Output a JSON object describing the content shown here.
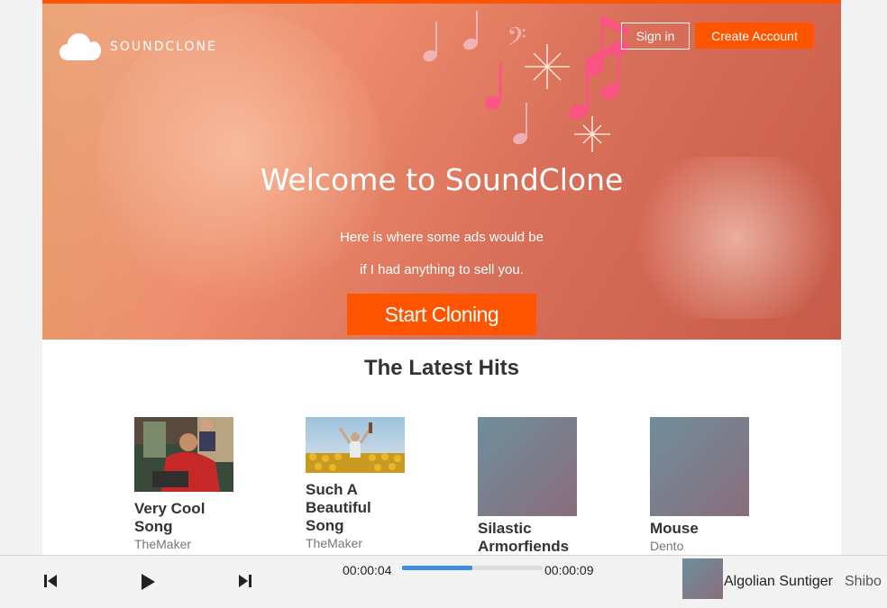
{
  "header": {
    "logo_text": "SOUNDCLONE",
    "signin_label": "Sign in",
    "create_account_label": "Create Account"
  },
  "hero": {
    "title": "Welcome to SoundClone",
    "subtitle_line1": "Here is where some ads would be",
    "subtitle_line2": "if I had anything to sell you.",
    "cta_label": "Start Cloning"
  },
  "latest": {
    "heading": "The Latest Hits",
    "tracks": [
      {
        "title": "Very Cool Song",
        "artist": "TheMaker",
        "art": "photo-people-street"
      },
      {
        "title": "Such A Beautiful Song",
        "artist": "TheMaker",
        "art": "photo-sunflower-field"
      },
      {
        "title": "Silastic Armorfiends",
        "artist": "",
        "art": "gradient-placeholder"
      },
      {
        "title": "Mouse",
        "artist": "Dento",
        "art": "gradient-placeholder"
      }
    ]
  },
  "player": {
    "current_time": "00:00:04",
    "total_time": "00:00:09",
    "progress": 0.5,
    "now_playing_title": "Algolian Suntiger",
    "now_playing_artist": "Shibo",
    "icons": [
      "skip-back-icon",
      "play-icon",
      "skip-forward-icon"
    ]
  },
  "colors": {
    "accent": "#ff5500",
    "progress": "#3d8ddb"
  }
}
